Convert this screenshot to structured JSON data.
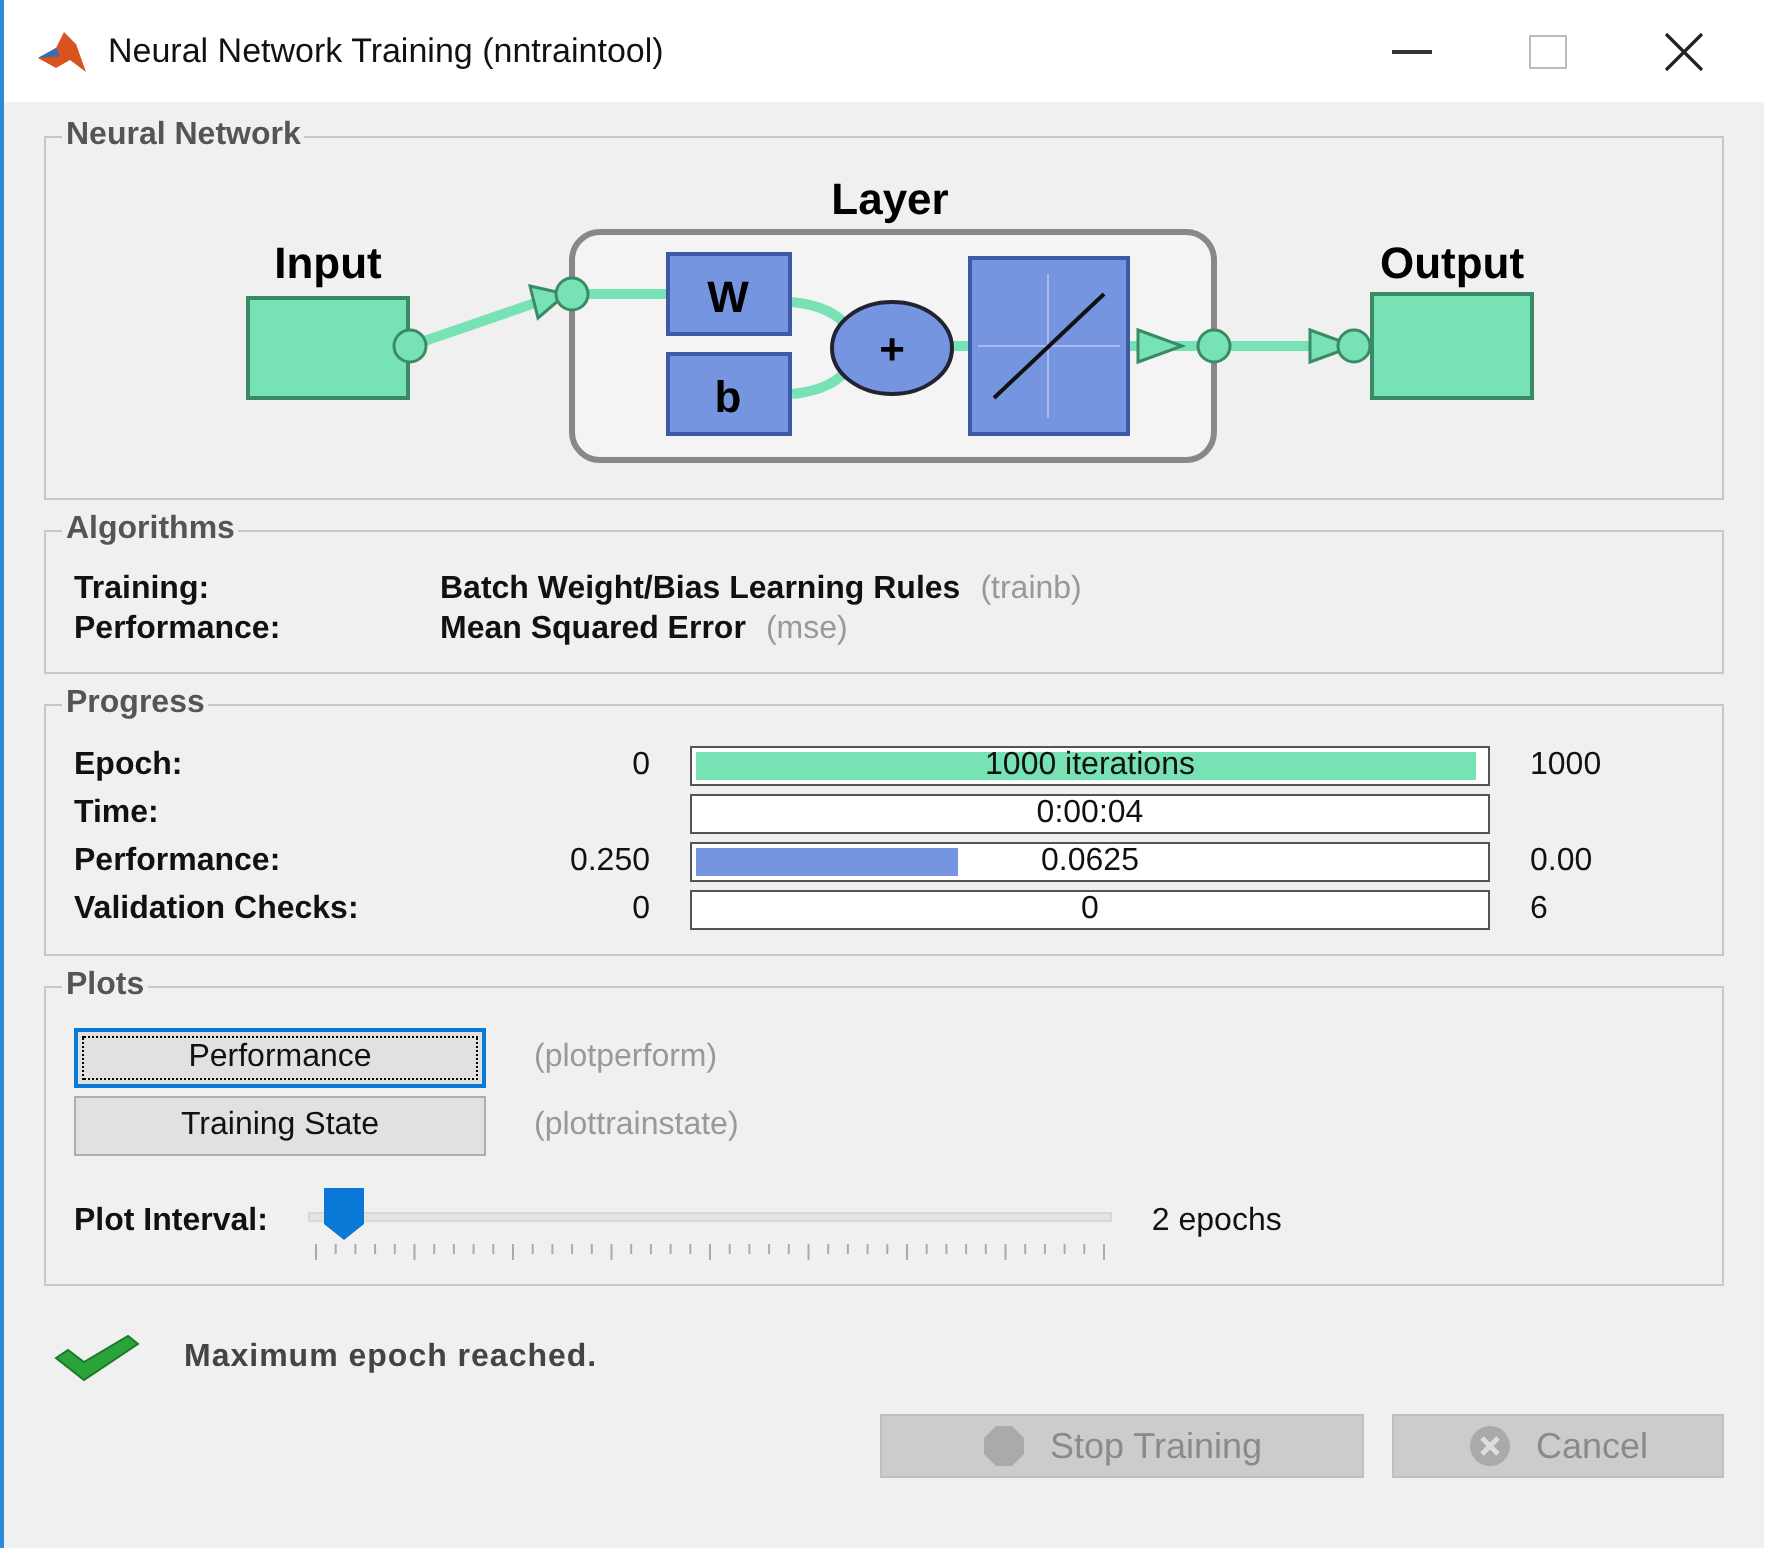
{
  "window": {
    "title": "Neural Network Training (nntraintool)"
  },
  "network": {
    "title": "Neural Network",
    "layer_label": "Layer",
    "input_label": "Input",
    "output_label": "Output",
    "weight_label": "W",
    "bias_label": "b",
    "sum_label": "+"
  },
  "algorithms": {
    "title": "Algorithms",
    "rows": [
      {
        "label": "Training:",
        "value": "Batch Weight/Bias Learning Rules",
        "code": "(trainb)"
      },
      {
        "label": "Performance:",
        "value": "Mean Squared Error",
        "code": "(mse)"
      }
    ]
  },
  "progress": {
    "title": "Progress",
    "rows": [
      {
        "label": "Epoch:",
        "min": "0",
        "text": "1000 iterations",
        "max": "1000",
        "level": 0.99,
        "color": "#77e2b3"
      },
      {
        "label": "Time:",
        "text": "0:00:04"
      },
      {
        "label": "Performance:",
        "min": "0.250",
        "text": "0.0625",
        "max": "0.00",
        "level": 0.34,
        "color": "#7595e0"
      },
      {
        "label": "Validation Checks:",
        "min": "0",
        "text": "0",
        "max": "6"
      }
    ]
  },
  "plots": {
    "title": "Plots",
    "buttons": [
      {
        "label": "Performance",
        "code": "(plotperform)",
        "focused": true
      },
      {
        "label": "Training State",
        "code": "(plottrainstate)",
        "focused": false
      }
    ],
    "interval_label": "Plot Interval:",
    "interval": {
      "level": 0.02
    },
    "interval_value": "2 epochs"
  },
  "status": {
    "message": "Maximum epoch reached."
  },
  "buttons": [
    {
      "label": "Stop Training",
      "kind": "stop",
      "disabled": true
    },
    {
      "label": "Cancel",
      "kind": "cancel",
      "disabled": true
    }
  ]
}
